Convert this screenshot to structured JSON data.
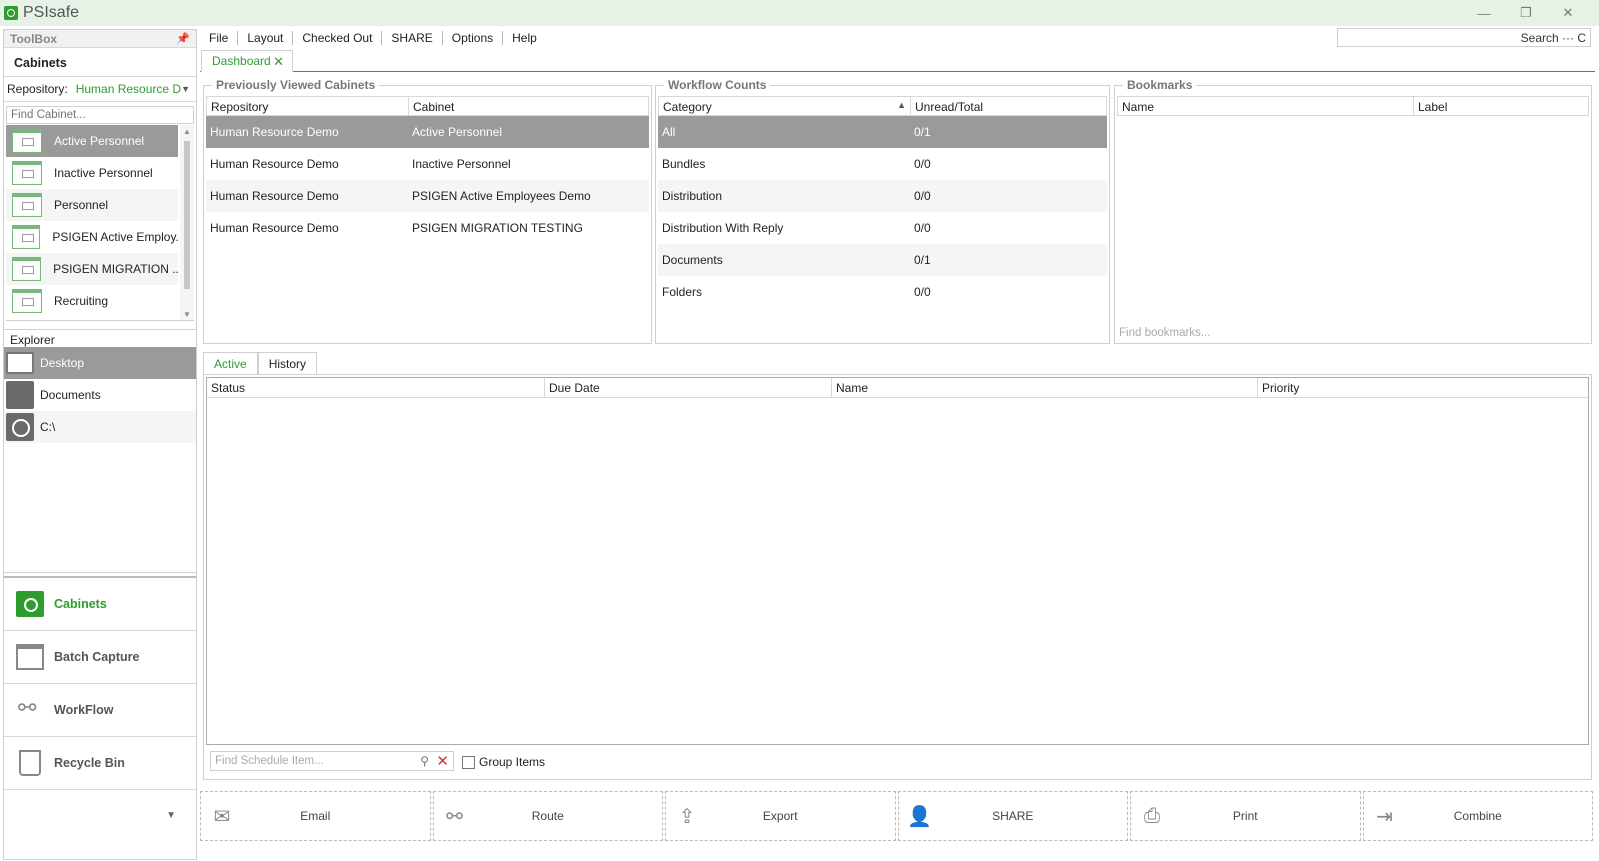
{
  "app": {
    "title": "PSIsafe"
  },
  "window": {
    "minimize": "—",
    "restore": "❐",
    "close": "✕"
  },
  "toolbox": {
    "title": "ToolBox",
    "cabinets_title": "Cabinets",
    "repository_label": "Repository:",
    "repository_value": "Human Resource De...",
    "find_cabinet_placeholder": "Find Cabinet...",
    "cabinets": [
      "Active Personnel",
      "Inactive Personnel",
      "Personnel",
      "PSIGEN Active Employ...",
      "PSIGEN MIGRATION ...",
      "Recruiting"
    ],
    "explorer_title": "Explorer",
    "explorer_items": [
      "Desktop",
      "Documents",
      "C:\\"
    ],
    "nav": [
      "Cabinets",
      "Batch Capture",
      "WorkFlow",
      "Recycle Bin"
    ]
  },
  "menu": [
    "File",
    "Layout",
    "Checked Out",
    "SHARE",
    "Options",
    "Help"
  ],
  "search": {
    "label": "Search ··· C"
  },
  "doc_tab": {
    "label": "Dashboard",
    "close": "✕"
  },
  "previously_viewed": {
    "title": "Previously Viewed Cabinets",
    "columns": [
      "Repository",
      "Cabinet"
    ],
    "rows": [
      [
        "Human Resource Demo",
        "Active Personnel"
      ],
      [
        "Human Resource Demo",
        "Inactive Personnel"
      ],
      [
        "Human Resource Demo",
        "PSIGEN Active Employees Demo"
      ],
      [
        "Human Resource Demo",
        "PSIGEN MIGRATION TESTING"
      ]
    ]
  },
  "workflow_counts": {
    "title": "Workflow Counts",
    "columns": [
      "Category",
      "Unread/Total"
    ],
    "rows": [
      [
        "All",
        "0/1"
      ],
      [
        "Bundles",
        "0/0"
      ],
      [
        "Distribution",
        "0/0"
      ],
      [
        "Distribution With Reply",
        "0/0"
      ],
      [
        "Documents",
        "0/1"
      ],
      [
        "Folders",
        "0/0"
      ]
    ]
  },
  "bookmarks": {
    "title": "Bookmarks",
    "columns": [
      "Name",
      "Label"
    ],
    "find_placeholder": "Find bookmarks..."
  },
  "schedule": {
    "tabs": [
      "Active",
      "History"
    ],
    "columns": [
      "Status",
      "Due Date",
      "Name",
      "Priority"
    ],
    "find_placeholder": "Find Schedule Item...",
    "group_items": "Group Items"
  },
  "actions": [
    "Email",
    "Route",
    "Export",
    "SHARE",
    "Print",
    "Combine"
  ],
  "colors": {
    "accent": "#2e9c2e",
    "selected_row": "#9a9a9a",
    "titlebar": "#e6f2e6"
  }
}
